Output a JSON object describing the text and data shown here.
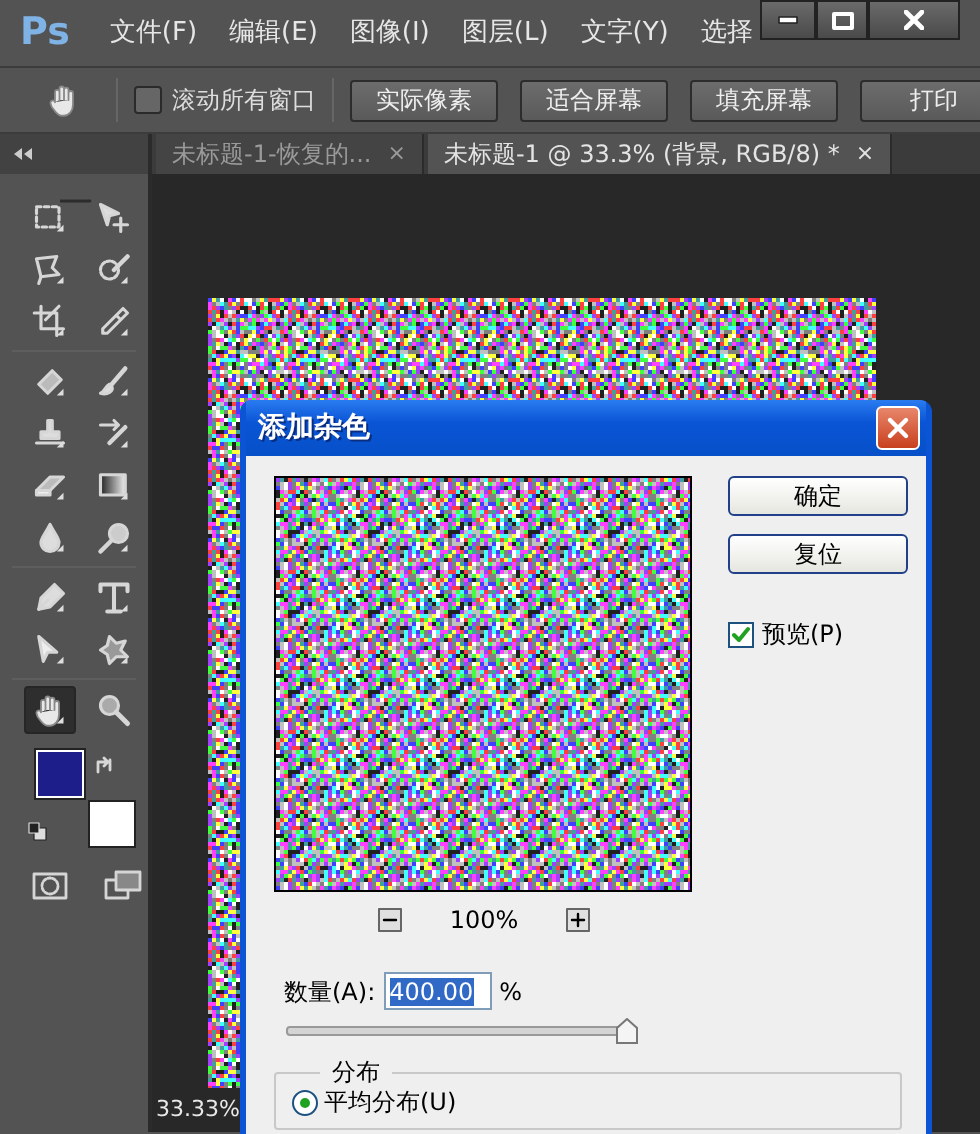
{
  "app": {
    "logo": "Ps"
  },
  "menu": [
    {
      "label": "文件(F)"
    },
    {
      "label": "编辑(E)"
    },
    {
      "label": "图像(I)"
    },
    {
      "label": "图层(L)"
    },
    {
      "label": "文字(Y)"
    },
    {
      "label": "选择"
    }
  ],
  "options_bar": {
    "scroll_all": {
      "label": "滚动所有窗口",
      "checked": false
    },
    "buttons": [
      "实际像素",
      "适合屏幕",
      "填充屏幕",
      "打印"
    ]
  },
  "tabs": [
    {
      "label": "未标题-1-恢复的...",
      "close": "×",
      "selected": false
    },
    {
      "label": "未标题-1 @ 33.3% (背景, RGB/8) *",
      "close": "×",
      "selected": true
    }
  ],
  "tools": [
    {
      "selected": false
    },
    {
      "selected": false
    },
    {
      "selected": false
    },
    {
      "selected": false
    },
    {
      "selected": false
    },
    {
      "selected": false
    },
    {
      "selected": false
    },
    {
      "selected": false
    },
    {
      "selected": false
    },
    {
      "selected": false
    },
    {
      "selected": false
    },
    {
      "selected": false
    },
    {
      "selected": false
    },
    {
      "selected": false
    },
    {
      "selected": false
    },
    {
      "selected": false
    },
    {
      "selected": false
    },
    {
      "selected": false
    },
    {
      "selected": true
    },
    {
      "selected": false
    }
  ],
  "color_swatches": [
    {
      "color": "#1e1e8a"
    },
    {
      "color": "#ffffff"
    }
  ],
  "status_bar": {
    "zoom": "33.33%"
  },
  "dialog": {
    "title": "添加杂色",
    "buttons": [
      "确定",
      "复位"
    ],
    "preview": {
      "label": "预览(P)",
      "checked": true
    },
    "zoom": {
      "value": "100%"
    },
    "amount": {
      "label": "数量(A):",
      "value": "400.00",
      "unit": "%",
      "level": 1
    },
    "distribution": {
      "legend": "分布",
      "options": [
        {
          "label": "平均分布(U)",
          "selected": true
        }
      ]
    }
  }
}
